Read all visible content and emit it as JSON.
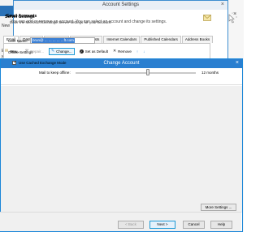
{
  "background": {
    "left_items": [
      "New",
      "Emai",
      "Ne"
    ],
    "close_glyph": "×"
  },
  "account_settings": {
    "title": "Account Settings",
    "close_glyph": "×",
    "heading": "Email Accounts",
    "description": "You can add or remove an account. You can select an account and change its settings.",
    "tabs": [
      "Email",
      "Data Files",
      "RSS Feeds",
      "SharePoint Lists",
      "Internet Calendars",
      "Published Calendars",
      "Address Books"
    ],
    "active_tab": "Email",
    "toolbar": {
      "new_label": "New...",
      "repair_label": "Repair...",
      "change_label": "Change...",
      "set_default_label": "Set as Default",
      "remove_label": "Remove",
      "move_up_glyph": "↑",
      "move_down_glyph": "↓"
    }
  },
  "change_account": {
    "title": "Change Account",
    "close_glyph": "×",
    "section_title": "Server Settings",
    "section_description": "Enter the Microsoft Exchange Server settings for your account.",
    "user_name_label": "User Name:",
    "user_name_value": "brun@ ... ... ... ... ...ft.com",
    "offline_settings_label": "Offline Settings",
    "use_cached_exchange_mode_label": "Use Cached Exchange Mode",
    "use_cached_exchange_mode_checked": true,
    "mail_to_keep_offline_label": "Mail to keep offline:",
    "mail_to_keep_offline_value": "12 months",
    "slider_fraction": 0.6,
    "more_settings_label": "More Settings ...",
    "buttons": {
      "back_label": "< Back",
      "next_label": "Next >",
      "cancel_label": "Cancel",
      "help_label": "Help"
    }
  },
  "colors": {
    "dialog_titlebar": "#2a7fd0",
    "highlight_border": "#1e9ad6",
    "selection": "#3b7fd4"
  }
}
